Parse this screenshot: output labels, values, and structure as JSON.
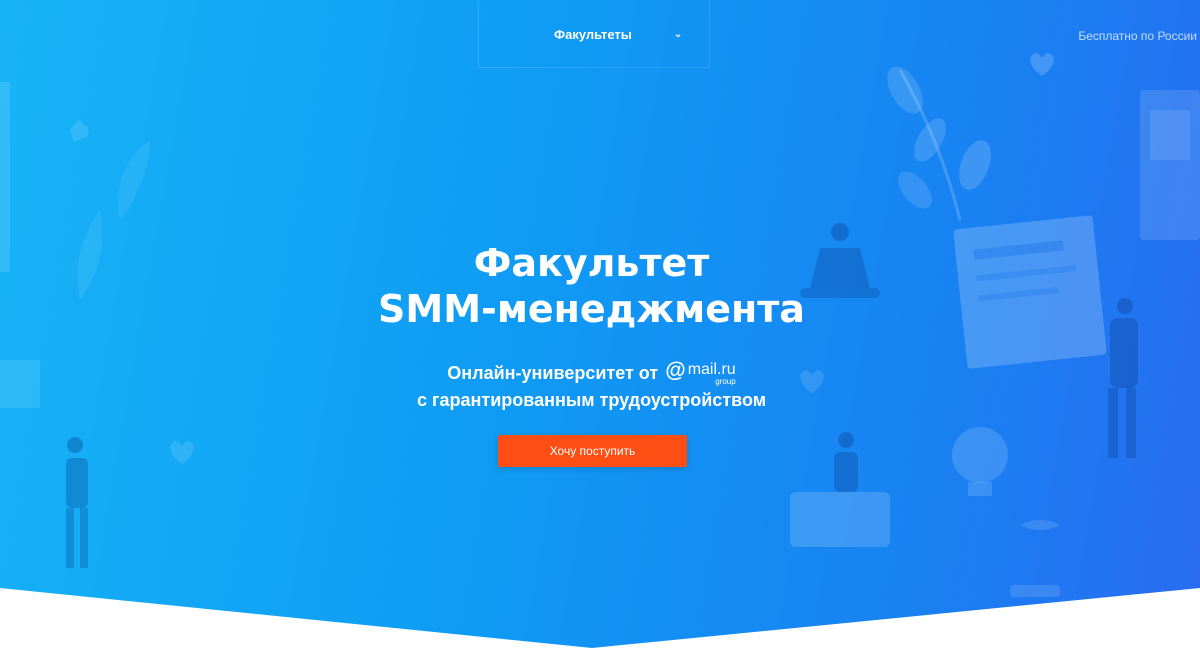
{
  "nav": {
    "faculties_label": "Факультеты",
    "chevron_icon": "chevron-down-icon",
    "phone_note": "Бесплатно по России"
  },
  "hero": {
    "title_line1": "Факультет",
    "title_line2": "SMM-менеджмента",
    "subtitle_line1": "Онлайн-университет от",
    "subtitle_line2": "с гарантированным трудоустройством",
    "cta_label": "Хочу поступить"
  },
  "logo": {
    "at_symbol": "@",
    "brand": "mail.ru",
    "group": "group"
  },
  "colors": {
    "hero_left": "#17b4f6",
    "hero_right": "#2a6bf0",
    "cta": "#fd4e13",
    "background": "#ffffff"
  }
}
